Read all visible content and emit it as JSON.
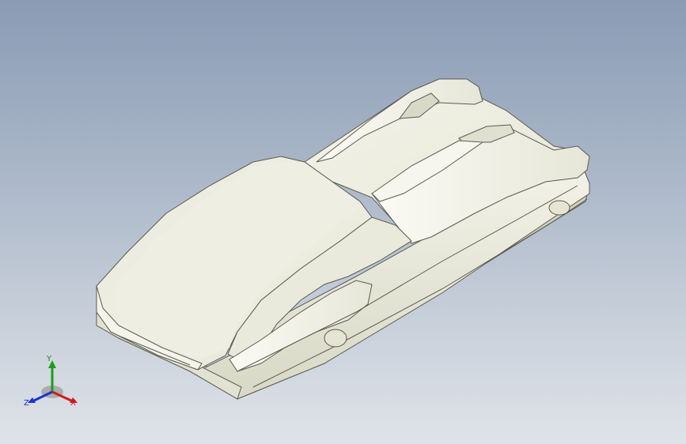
{
  "viewport": {
    "background_top": "#8a9bb4",
    "background_bottom": "#dfe3e9",
    "model_color": "#f2f2e4",
    "edge_color": "#5a5a52"
  },
  "triad": {
    "x_label": "X",
    "y_label": "Y",
    "z_label": "Z",
    "x_color": "#d01c1c",
    "y_color": "#1c9c1c",
    "z_color": "#1c34d0"
  }
}
